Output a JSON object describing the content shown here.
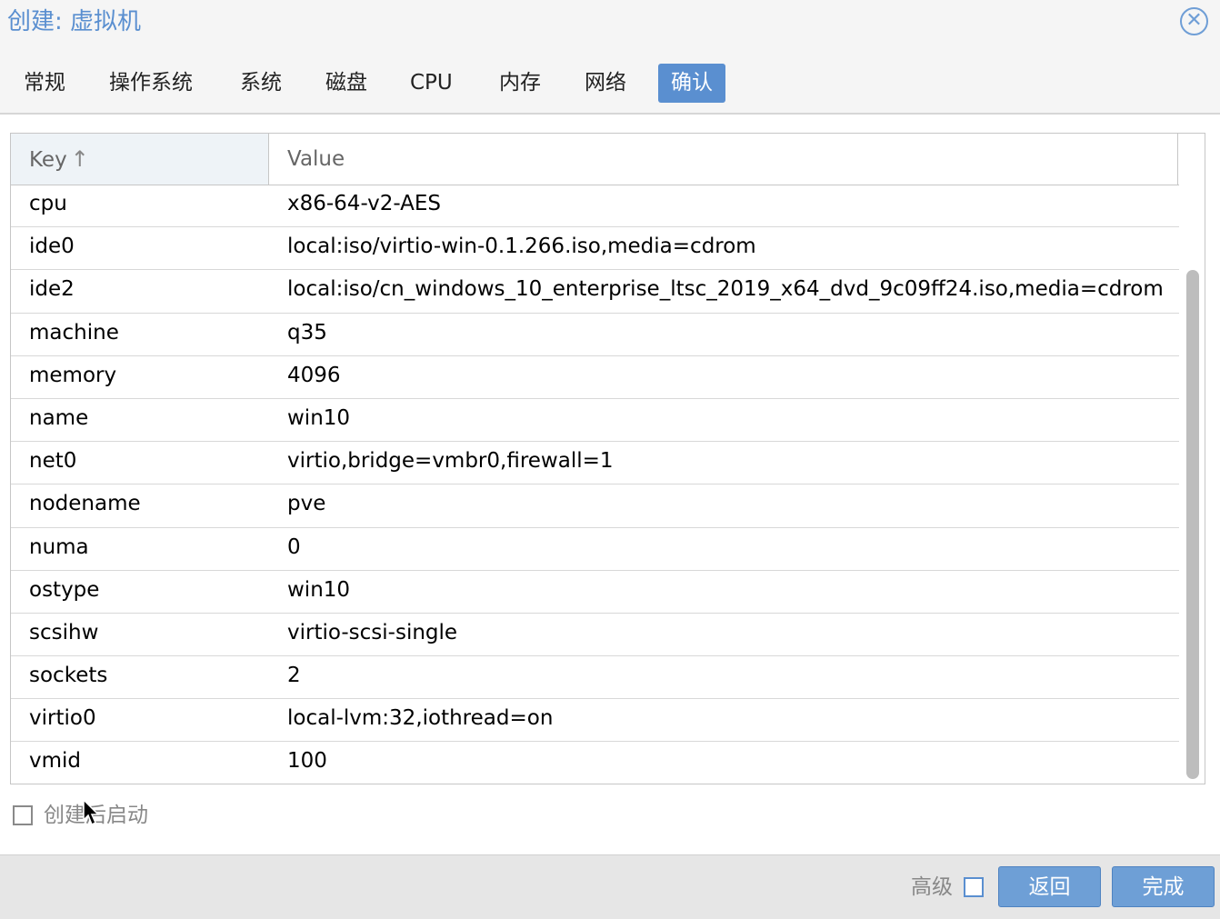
{
  "window": {
    "title": "创建: 虚拟机",
    "close_icon": "close-icon"
  },
  "tabs": [
    {
      "label": "常规"
    },
    {
      "label": "操作系统"
    },
    {
      "label": "系统"
    },
    {
      "label": "磁盘"
    },
    {
      "label": "CPU"
    },
    {
      "label": "内存"
    },
    {
      "label": "网络"
    },
    {
      "label": "确认",
      "active": true
    }
  ],
  "grid": {
    "columns": {
      "key": "Key",
      "value": "Value",
      "sort_icon": "sort-ascending-icon"
    },
    "rows": [
      {
        "key": "cpu",
        "value": "x86-64-v2-AES"
      },
      {
        "key": "ide0",
        "value": "local:iso/virtio-win-0.1.266.iso,media=cdrom"
      },
      {
        "key": "ide2",
        "value": "local:iso/cn_windows_10_enterprise_ltsc_2019_x64_dvd_9c09ff24.iso,media=cdrom"
      },
      {
        "key": "machine",
        "value": "q35"
      },
      {
        "key": "memory",
        "value": "4096"
      },
      {
        "key": "name",
        "value": "win10"
      },
      {
        "key": "net0",
        "value": "virtio,bridge=vmbr0,firewall=1"
      },
      {
        "key": "nodename",
        "value": "pve"
      },
      {
        "key": "numa",
        "value": "0"
      },
      {
        "key": "ostype",
        "value": "win10"
      },
      {
        "key": "scsihw",
        "value": "virtio-scsi-single"
      },
      {
        "key": "sockets",
        "value": "2"
      },
      {
        "key": "virtio0",
        "value": "local-lvm:32,iothread=on"
      },
      {
        "key": "vmid",
        "value": "100"
      }
    ]
  },
  "start_after_create": {
    "label": "创建后启动",
    "checked": false
  },
  "footer": {
    "advanced_label": "高级",
    "advanced_checked": false,
    "back_label": "返回",
    "finish_label": "完成"
  },
  "colors": {
    "accent": "#5a8fd0",
    "button": "#6e9fd6"
  }
}
